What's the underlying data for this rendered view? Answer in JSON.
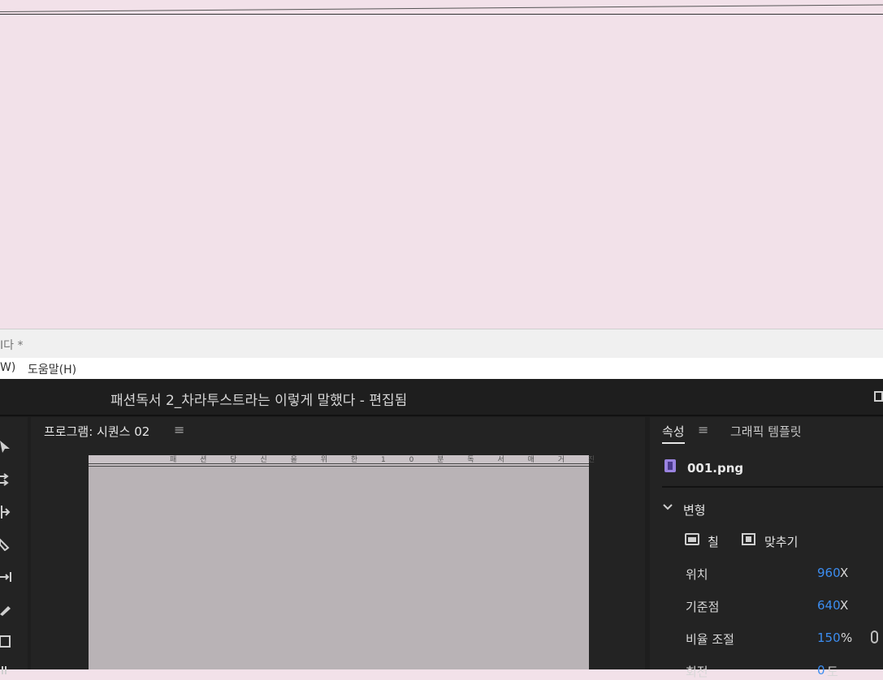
{
  "preview_top": {
    "faint_caption": "·   ·   ·   ·   ·   ·   ·"
  },
  "notepad": {
    "window_title": "I다 *",
    "menu_fragment": "W)",
    "menu_help": "도움말(H)"
  },
  "app": {
    "title": "패션독서 2_차라투스트라는 이렇게 말했다 - 편집됨"
  },
  "program_monitor": {
    "tab_label": "프로그램: 시퀀스 02",
    "menu_glyph": "≡",
    "frame_header_text": "패 션 당 신 을 위 한 1 0 분 독 서 매 거 진"
  },
  "properties": {
    "tab_label": "속성",
    "menu_glyph": "≡",
    "tab2_label": "그래픽 템플릿",
    "file_name": "001.png",
    "section_label": "변형",
    "fill_label": "칠",
    "fit_label": "맞추기",
    "rows": [
      {
        "label": "위치",
        "value": "960",
        "unit": "X"
      },
      {
        "label": "기준점",
        "value": "640",
        "unit": "X"
      },
      {
        "label": "비율 조절",
        "value": "150",
        "unit": "%"
      },
      {
        "label": "회전",
        "value": "0",
        "unit": "도"
      }
    ]
  },
  "colors": {
    "accent_value": "#3c8df0",
    "preview_pink": "#f2e1e9",
    "panel_bg": "#232323"
  },
  "icons": [
    "selection-tool-icon",
    "track-select-icon",
    "ripple-edit-icon",
    "razor-icon",
    "slip-icon",
    "pen-icon",
    "rectangle-icon",
    "hand-icon",
    "film-file-icon",
    "chevron-down-icon",
    "fill-frame-icon",
    "fit-frame-icon",
    "link-icon",
    "window-icon"
  ]
}
